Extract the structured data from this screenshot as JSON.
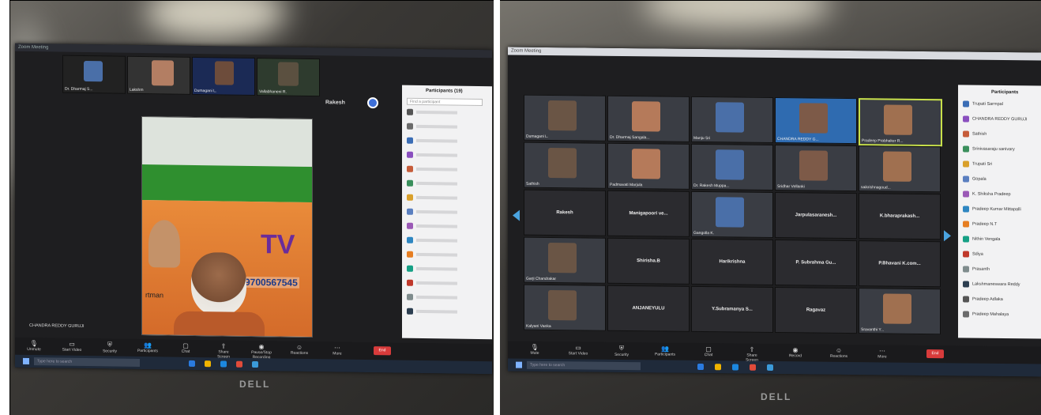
{
  "left": {
    "top_strip": [
      "Dr. Dharmaj S...",
      "Lakshm",
      "Dumagani L.",
      "Vallabhaneni R."
    ],
    "host_name": "Rakesh",
    "banner_text": "TV",
    "phone": "9700567545",
    "caption_line": "rtman",
    "speaker_label": "CHANDRA REDDY GURUJI",
    "participants_title": "Participants (19)",
    "search_placeholder": "Find a participant",
    "toolbar": [
      {
        "icon": "mic-icon",
        "label": "Unmute"
      },
      {
        "icon": "video-icon",
        "label": "Start Video"
      },
      {
        "icon": "shield-icon",
        "label": "Security"
      },
      {
        "icon": "people-icon",
        "label": "Participants"
      },
      {
        "icon": "chat-icon",
        "label": "Chat"
      },
      {
        "icon": "share-icon",
        "label": "Share Screen"
      },
      {
        "icon": "record-icon",
        "label": "Pause/Stop Recording"
      },
      {
        "icon": "reaction-icon",
        "label": "Reactions"
      },
      {
        "icon": "more-icon",
        "label": "More"
      }
    ],
    "end_label": "End",
    "taskbar_search": "Type here to search",
    "brand": "DELL"
  },
  "right": {
    "window_title": "Zoom Meeting",
    "panel_title": "Participants",
    "grid": [
      [
        "Dumagani L.",
        "Dr. Dharmaj Sangala...",
        "Manju Sri",
        "CHANDRA REDDY G...",
        "Pradeep Prabhaker R..."
      ],
      [
        "Sathish",
        "Padmavati Marjula",
        "Dr. Rakesh Muppa...",
        "Sridhar Vellanki",
        "saikrishnagoud..."
      ],
      [
        "Rakesh",
        "Manigapoori ve...",
        "Gangolla K.",
        "Jarpulasaranesh...",
        "K.bharaprakash..."
      ],
      [
        "Garji Chandrakar",
        "Shirisha.B",
        "Harikrishna",
        "P. Subrahma Gu...",
        "P.Bhavani K.com..."
      ],
      [
        "Kalyani Vanka",
        "ANJANEYULU",
        "Y.Subramanya S...",
        "Ragavaz",
        "Sravanthi Y..."
      ]
    ],
    "participants": [
      "Trupati Sarmpal",
      "CHANDRA REDDY GURUJI",
      "Sathish",
      "Srinivasaraju sanivary",
      "Trupati Sri",
      "Gopala",
      "K. Shiksha Pradeep",
      "Pradeep Kumar Mittapalli",
      "Pradeep N.T",
      "Nithin Vengala",
      "Sdiya",
      "Prasanth",
      "Lakshmaneswara Reddy",
      "Pradeep Adlaka",
      "Pradeep Mahalaya"
    ],
    "toolbar": [
      {
        "icon": "mic-icon",
        "label": "Mute"
      },
      {
        "icon": "video-icon",
        "label": "Start Video"
      },
      {
        "icon": "shield-icon",
        "label": "Security"
      },
      {
        "icon": "people-icon",
        "label": "Participants"
      },
      {
        "icon": "chat-icon",
        "label": "Chat"
      },
      {
        "icon": "share-icon",
        "label": "Share Screen"
      },
      {
        "icon": "record-icon",
        "label": "Record"
      },
      {
        "icon": "reaction-icon",
        "label": "Reactions"
      },
      {
        "icon": "more-icon",
        "label": "More"
      }
    ],
    "end_label": "End",
    "taskbar_search": "Type here to search",
    "brand": "DELL"
  }
}
